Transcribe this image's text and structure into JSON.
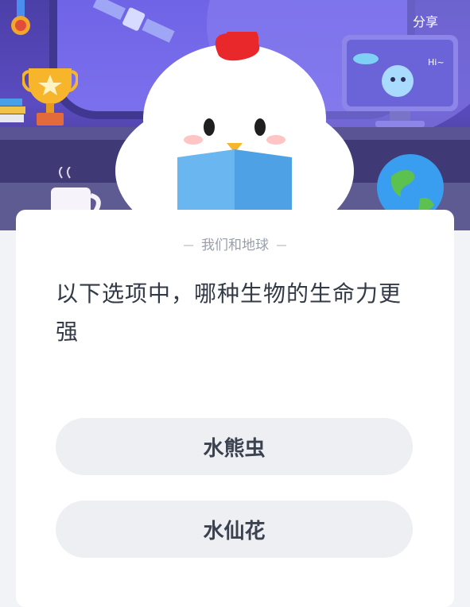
{
  "header": {
    "share_label": "分享"
  },
  "scene": {
    "monitor_greeting": "Hi~"
  },
  "quiz": {
    "category": "我们和地球",
    "question": "以下选项中，哪种生物的生命力更强",
    "options": [
      {
        "label": "水熊虫"
      },
      {
        "label": "水仙花"
      }
    ]
  },
  "colors": {
    "hero_background": "#5b4cc0",
    "card_background": "#ffffff",
    "option_background": "#eeeff2",
    "question_text": "#333a47",
    "category_text": "#9aa0ab"
  }
}
